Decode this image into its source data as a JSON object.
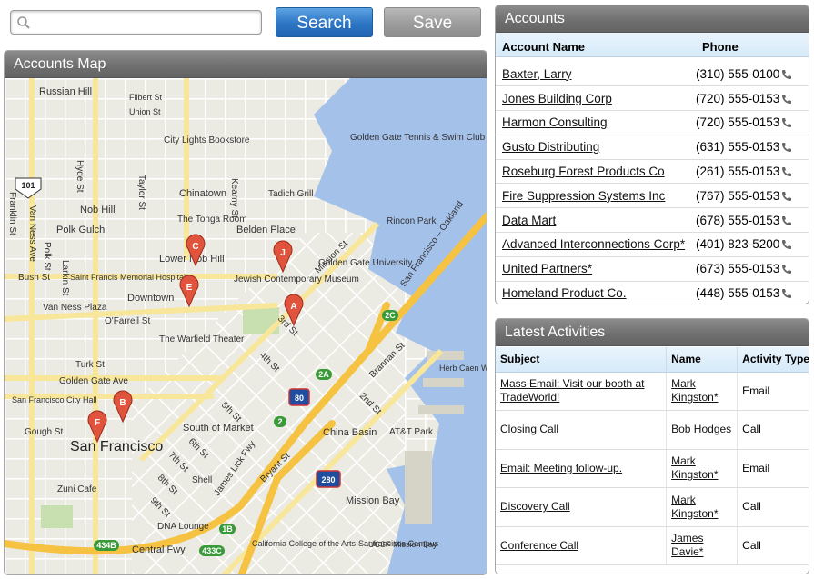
{
  "search": {
    "placeholder": "",
    "value": ""
  },
  "toolbar": {
    "search_label": "Search",
    "save_label": "Save"
  },
  "map": {
    "title": "Accounts Map",
    "place_labels": [
      "Russian Hill",
      "Filbert St",
      "Union St",
      "City Lights Bookstore",
      "Golden Gate Tennis & Swim Club",
      "Chinatown",
      "Tadich Grill",
      "Nob Hill",
      "The Tonga Room",
      "Belden Place",
      "Rincon Park",
      "Polk Gulch",
      "Lower Nob Hill",
      "Saint Francis Memorial Hospital",
      "Jewish Contemporary Museum",
      "Golden Gate University",
      "Bush St",
      "Van Ness Plaza",
      "Downtown",
      "O'Farrell St",
      "The Warfield Theater",
      "Turk St",
      "Golden Gate Ave",
      "San Francisco City Hall",
      "Gough St",
      "South of Market",
      "China Basin",
      "AT&T Park",
      "Herb Caen Way",
      "San Francisco",
      "Shell",
      "Zuni Cafe",
      "Mission Bay",
      "DNA Lounge",
      "California College of the Arts-Sanfrancisco Campus",
      "UCSF Mission Bay",
      "Central Fwy",
      "James Lick Fwy",
      "San Francisco – Oakland",
      "Mission St",
      "3rd St",
      "4th St",
      "5th St",
      "6th St",
      "7th St",
      "8th St",
      "9th St",
      "2nd St",
      "Brannan St",
      "Bryant St",
      "Hyde St",
      "Taylor St",
      "Kearny St",
      "Van Ness Ave",
      "Franklin St",
      "Polk St",
      "Larkin St"
    ],
    "shields": [
      "101",
      "80",
      "280",
      "1B",
      "2",
      "2A",
      "2C",
      "434B",
      "433C"
    ],
    "markers": [
      "A",
      "B",
      "C",
      "E",
      "F",
      "J"
    ]
  },
  "accounts": {
    "title": "Accounts",
    "columns": [
      "Account Name",
      "Phone"
    ],
    "rows": [
      {
        "name": "Baxter, Larry",
        "phone": "(310) 555-0100"
      },
      {
        "name": "Jones Building Corp",
        "phone": "(720) 555-0153"
      },
      {
        "name": "Harmon Consulting",
        "phone": "(720) 555-0153"
      },
      {
        "name": "Gusto Distributing",
        "phone": "(631) 555-0153"
      },
      {
        "name": "Roseburg Forest Products Co",
        "phone": "(261) 555-0153"
      },
      {
        "name": "Fire Suppression Systems Inc",
        "phone": "(767) 555-0153"
      },
      {
        "name": "Data Mart",
        "phone": "(678) 555-0153"
      },
      {
        "name": "Advanced Interconnections Corp*",
        "phone": "(401) 823-5200"
      },
      {
        "name": "United Partners*",
        "phone": "(673) 555-0153"
      },
      {
        "name": "Homeland Product Co.",
        "phone": "(448) 555-0153"
      }
    ]
  },
  "activities": {
    "title": "Latest Activities",
    "columns": [
      "Subject",
      "Name",
      "Activity Type"
    ],
    "rows": [
      {
        "subject": "Mass Email: Visit our booth at TradeWorld!",
        "name": "Mark Kingston*",
        "type": "Email"
      },
      {
        "subject": "Closing Call",
        "name": "Bob Hodges",
        "type": "Call"
      },
      {
        "subject": "Email: Meeting follow-up.",
        "name": "Mark Kingston*",
        "type": "Email"
      },
      {
        "subject": "Discovery Call",
        "name": "Mark Kingston*",
        "type": "Call"
      },
      {
        "subject": "Conference Call",
        "name": "James Davie*",
        "type": "Call"
      }
    ]
  },
  "colors": {
    "search_button": "#2d75c4",
    "save_button": "#9c9c9c",
    "header": "#6e6e6e",
    "marker": "#e0533c",
    "water": "#a4c1ea",
    "freeway": "#f5c242"
  }
}
